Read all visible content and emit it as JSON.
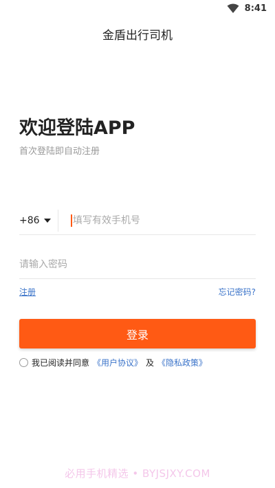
{
  "status_bar": {
    "time": "8:41"
  },
  "app_bar": {
    "title": "金盾出行司机"
  },
  "welcome": {
    "title": "欢迎登陆APP",
    "subtitle": "首次登陆即自动注册"
  },
  "phone": {
    "country_code": "+86",
    "placeholder": "填写有效手机号",
    "value": ""
  },
  "password": {
    "placeholder": "请输入密码",
    "value": ""
  },
  "links": {
    "register": "注册",
    "forgot_password": "忘记密码?"
  },
  "login_button": {
    "label": "登录"
  },
  "agreement": {
    "prefix": "我已阅读并同意",
    "user_agreement": "《用户协议》",
    "and": "及",
    "privacy_policy": "《隐私政策》",
    "checked": false
  },
  "watermark": {
    "text": "必用手机精选 • BYJSJXY.COM"
  },
  "colors": {
    "accent": "#ff5a14",
    "link": "#3a73c9",
    "watermark": "#f4c7ea"
  }
}
